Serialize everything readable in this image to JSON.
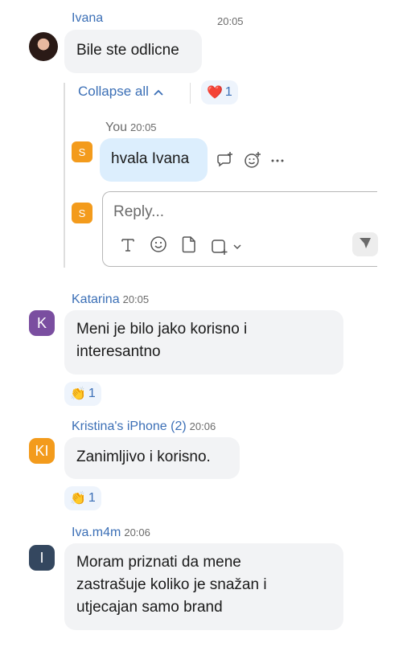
{
  "colors": {
    "link_blue": "#3b6fb6",
    "bubble_gray": "#f2f3f5",
    "bubble_self": "#dceefd",
    "avatar_orange": "#f39b1c",
    "avatar_purple": "#7a4ea0",
    "avatar_slate": "#34475f"
  },
  "messages": [
    {
      "sender": "Ivana",
      "time": "20:05",
      "text": "Bile ste odlicne",
      "avatar_icon": "user-photo"
    },
    {
      "sender": "Katarina",
      "time": "20:05",
      "text_lines": [
        "Meni je bilo jako korisno i",
        "interesantno"
      ],
      "avatar_initials": "K",
      "reaction": {
        "icon": "clapping-hands",
        "emoji": "👏",
        "count": "1"
      }
    },
    {
      "sender": "Kristina's iPhone (2)",
      "time": "20:06",
      "text": "Zanimljivo i korisno.",
      "avatar_initials": "KI",
      "reaction": {
        "icon": "clapping-hands",
        "emoji": "👏",
        "count": "1"
      }
    },
    {
      "sender": "Iva.m4m",
      "time": "20:06",
      "text_lines": [
        "Moram priznati da mene",
        "zastrašuje koliko je snažan i",
        "utjecajan samo brand"
      ],
      "avatar_initials": "I"
    }
  ],
  "thread": {
    "collapse_label": "Collapse all",
    "heart_reaction": {
      "icon": "heart",
      "emoji": "❤️",
      "count": "1"
    },
    "reply": {
      "sender": "You",
      "time": "20:05",
      "text": "hvala Ivana",
      "avatar_initials": "S"
    },
    "composer": {
      "avatar_initials": "S",
      "placeholder": "Reply...",
      "tools": [
        "text-format-icon",
        "emoji-icon",
        "file-icon",
        "screenshot-icon",
        "chevron-down-icon",
        "send-icon"
      ]
    }
  }
}
